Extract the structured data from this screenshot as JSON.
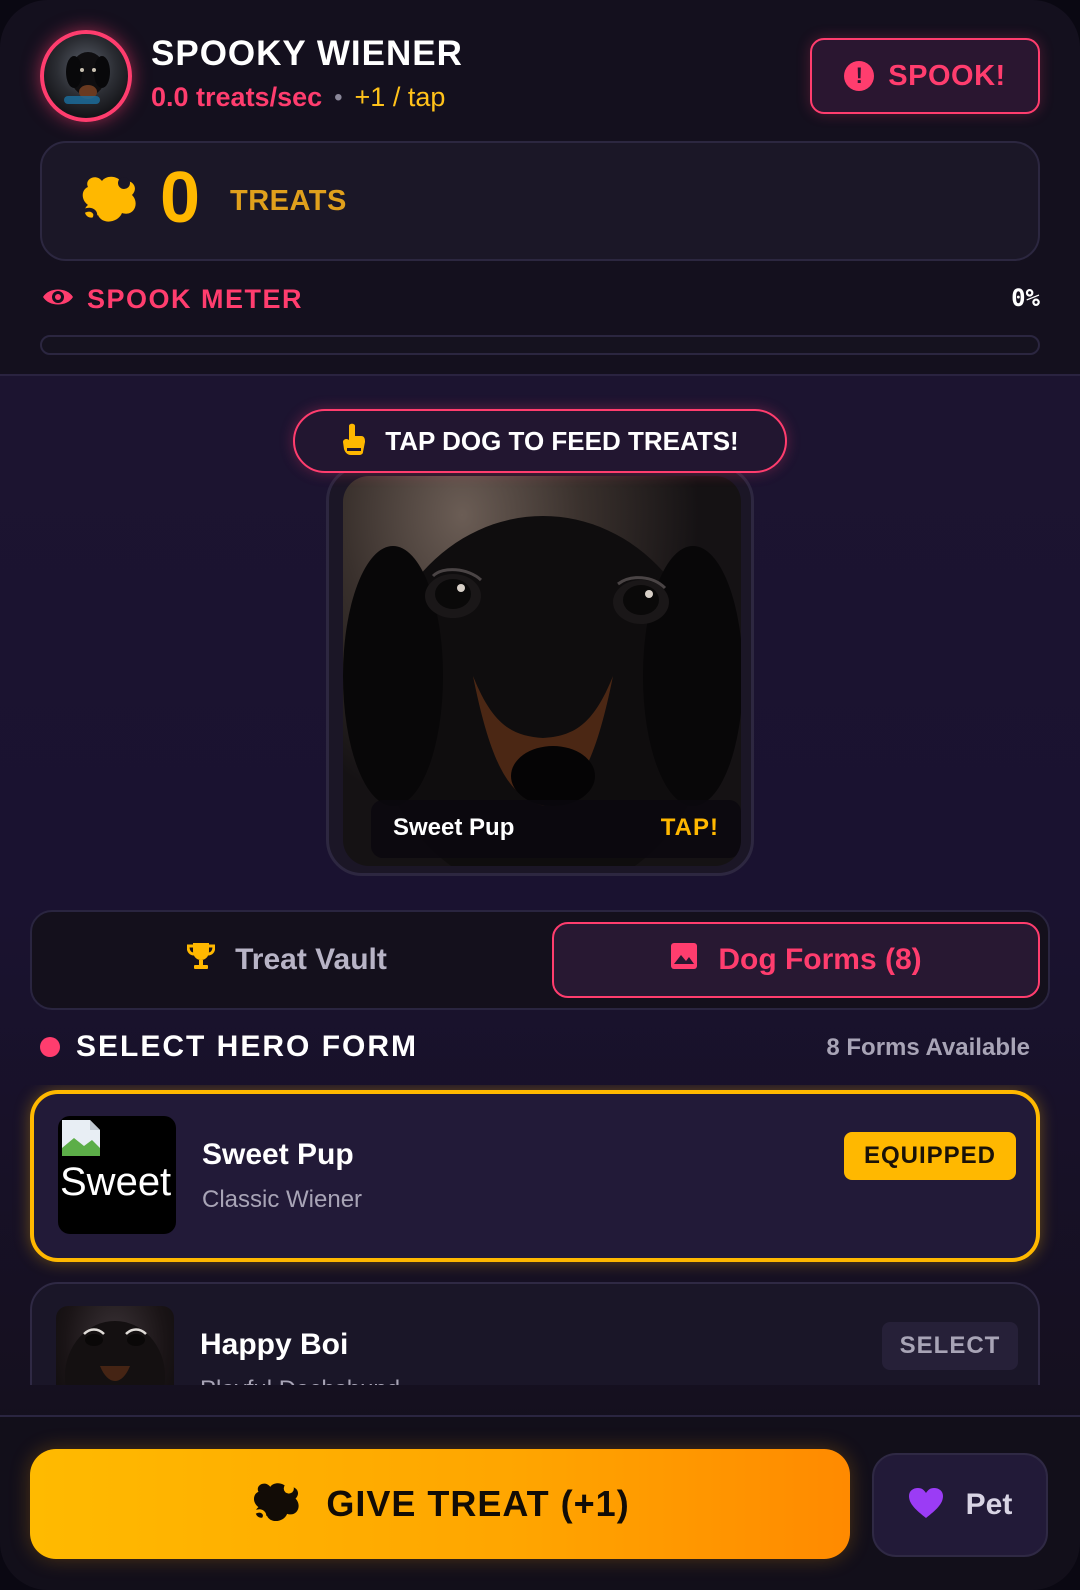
{
  "header": {
    "title": "SPOOKY WIENER",
    "rate": "0.0 treats/sec",
    "separator": "•",
    "per_tap": "+1 / tap",
    "spook_button": "SPOOK!"
  },
  "treats": {
    "count": "0",
    "label": "TREATS"
  },
  "spook_meter": {
    "label": "SPOOK METER",
    "percent_text": "0%",
    "level": 0
  },
  "tap_area": {
    "hint": "TAP DOG TO FEED TREATS!",
    "dog_name": "Sweet Pup",
    "tap_label": "TAP!"
  },
  "tabs": {
    "vault": "Treat Vault",
    "forms": "Dog Forms (8)"
  },
  "forms_section": {
    "title": "SELECT HERO FORM",
    "available": "8 Forms Available",
    "items": [
      {
        "name": "Sweet Pup",
        "subtitle": "Classic Wiener",
        "status": "EQUIPPED",
        "thumb_alt": "Sweet"
      },
      {
        "name": "Happy Boi",
        "subtitle": "Playful Dachshund",
        "status": "SELECT"
      }
    ]
  },
  "bottom": {
    "give_treat": "GIVE TREAT (+1)",
    "pet": "Pet"
  },
  "colors": {
    "accent_pink": "#ff3d6e",
    "accent_gold": "#ffb800",
    "background": "#14101e"
  },
  "icons": {
    "spook": "alert-circle-icon",
    "treats": "dog-treat-icon",
    "meter": "eye-icon",
    "hint": "hand-tap-icon",
    "vault": "trophy-icon",
    "forms": "image-icon",
    "pet": "heart-icon"
  }
}
